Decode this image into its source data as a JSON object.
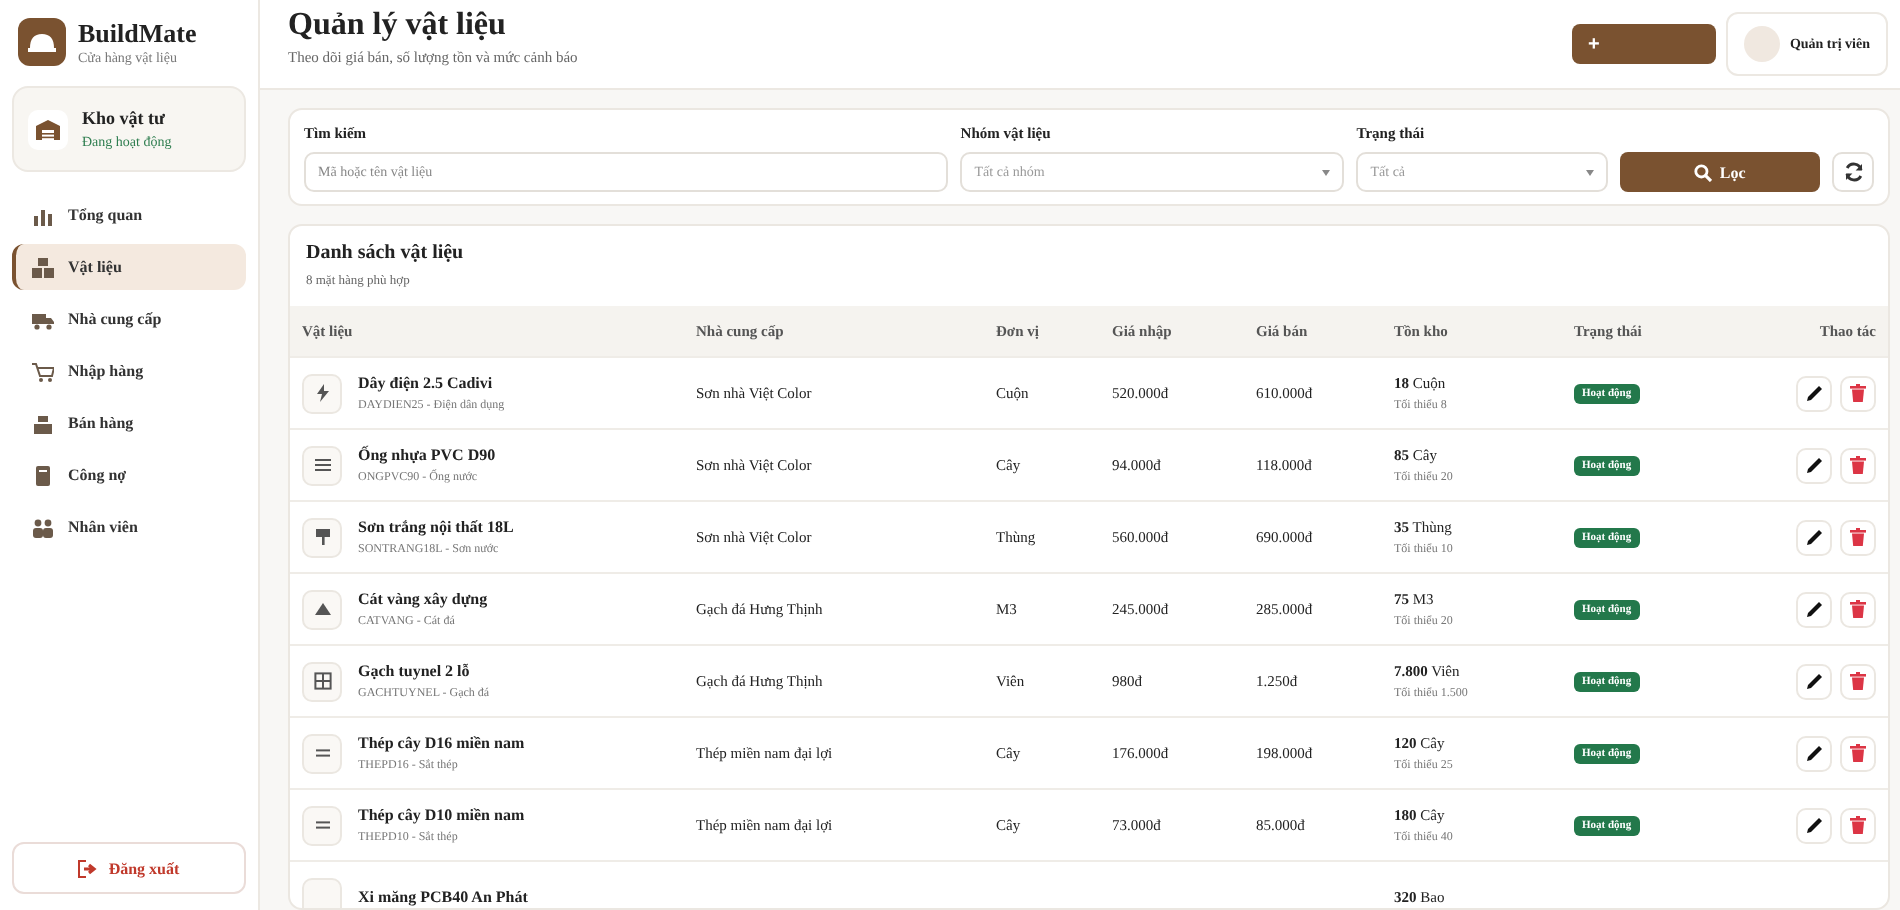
{
  "brand": {
    "name": "BuildMate",
    "tagline": "Cửa hàng vật liệu"
  },
  "store": {
    "name": "Kho vật tư",
    "status": "Đang hoạt động"
  },
  "nav": [
    {
      "label": "Tổng quan",
      "selected": false
    },
    {
      "label": "Vật liệu",
      "selected": true
    },
    {
      "label": "Nhà cung cấp",
      "selected": false
    },
    {
      "label": "Nhập hàng",
      "selected": false
    },
    {
      "label": "Bán hàng",
      "selected": false
    },
    {
      "label": "Công nợ",
      "selected": false
    },
    {
      "label": "Nhân viên",
      "selected": false
    }
  ],
  "logout": "Đăng xuất",
  "header": {
    "title": "Quản lý vật liệu",
    "subtitle": "Theo dõi giá bán, số lượng tồn và mức cảnh báo",
    "add_button": "+",
    "user": "Quản trị viên"
  },
  "filters": {
    "search": {
      "label": "Tìm kiếm",
      "placeholder": "Mã hoặc tên vật liệu"
    },
    "group": {
      "label": "Nhóm vật liệu",
      "placeholder": "Tất cả nhóm"
    },
    "status": {
      "label": "Trạng thái",
      "placeholder": "Tất cả"
    },
    "filter_button": "Lọc"
  },
  "table": {
    "title": "Danh sách vật liệu",
    "count": "8 mặt hàng phù hợp",
    "columns": [
      "Vật liệu",
      "Nhà cung cấp",
      "Đơn vị",
      "Giá nhập",
      "Giá bán",
      "Tồn kho",
      "Trạng thái",
      "Thao tác"
    ],
    "rows": [
      {
        "kind": "bolt",
        "name": "Dây điện 2.5 Cadivi",
        "code": "DAYDIEN25 - Điện dân dụng",
        "supplier": "Sơn nhà Việt Color",
        "unit": "Cuộn",
        "cost": "520.000đ",
        "price": "610.000đ",
        "stock": "18",
        "stock_unit": "Cuộn",
        "min": "Tối thiểu 8",
        "status": "Hoạt động"
      },
      {
        "kind": "lines",
        "name": "Ống nhựa PVC D90",
        "code": "ONGPVC90 - Ống nước",
        "supplier": "Sơn nhà Việt Color",
        "unit": "Cây",
        "cost": "94.000đ",
        "price": "118.000đ",
        "stock": "85",
        "stock_unit": "Cây",
        "min": "Tối thiểu 20",
        "status": "Hoạt động"
      },
      {
        "kind": "roller",
        "name": "Sơn trắng nội thất 18L",
        "code": "SONTRANG18L - Sơn nước",
        "supplier": "Sơn nhà Việt Color",
        "unit": "Thùng",
        "cost": "560.000đ",
        "price": "690.000đ",
        "stock": "35",
        "stock_unit": "Thùng",
        "min": "Tối thiểu 10",
        "status": "Hoạt động"
      },
      {
        "kind": "mound",
        "name": "Cát vàng xây dựng",
        "code": "CATVANG - Cát đá",
        "supplier": "Gạch đá Hưng Thịnh",
        "unit": "M3",
        "cost": "245.000đ",
        "price": "285.000đ",
        "stock": "75",
        "stock_unit": "M3",
        "min": "Tối thiểu 20",
        "status": "Hoạt động"
      },
      {
        "kind": "grid",
        "name": "Gạch tuynel 2 lỗ",
        "code": "GACHTUYNEL - Gạch đá",
        "supplier": "Gạch đá Hưng Thịnh",
        "unit": "Viên",
        "cost": "980đ",
        "price": "1.250đ",
        "stock": "7.800",
        "stock_unit": "Viên",
        "min": "Tối thiểu 1.500",
        "status": "Hoạt động"
      },
      {
        "kind": "bars",
        "name": "Thép cây D16 miền nam",
        "code": "THEPD16 - Sắt thép",
        "supplier": "Thép miền nam đại lợi",
        "unit": "Cây",
        "cost": "176.000đ",
        "price": "198.000đ",
        "stock": "120",
        "stock_unit": "Cây",
        "min": "Tối thiểu 25",
        "status": "Hoạt động"
      },
      {
        "kind": "bars",
        "name": "Thép cây D10 miền nam",
        "code": "THEPD10 - Sắt thép",
        "supplier": "Thép miền nam đại lợi",
        "unit": "Cây",
        "cost": "73.000đ",
        "price": "85.000đ",
        "stock": "180",
        "stock_unit": "Cây",
        "min": "Tối thiểu 40",
        "status": "Hoạt động"
      },
      {
        "kind": "partial",
        "name": "Xi măng PCB40 An Phát",
        "stock": "320",
        "stock_unit": "Bao"
      }
    ]
  }
}
